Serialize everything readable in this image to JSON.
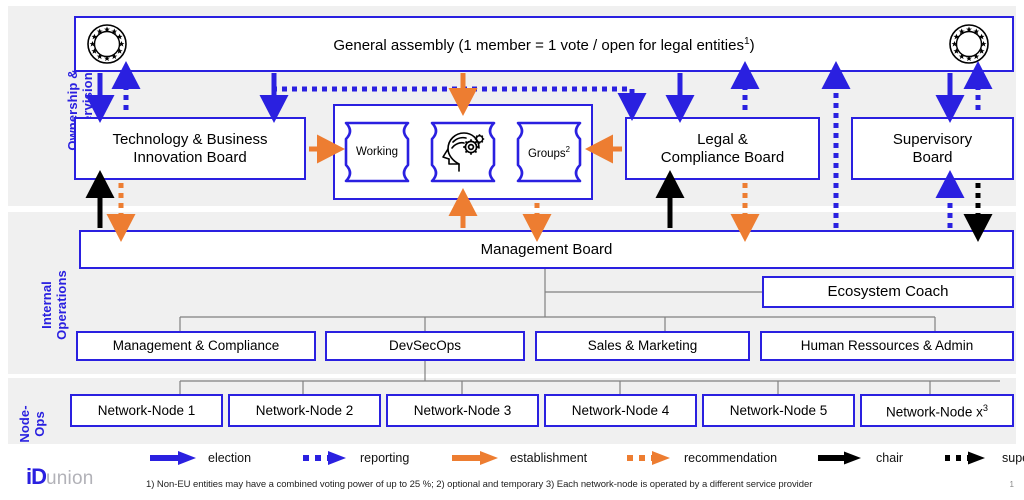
{
  "colors": {
    "blue": "#2a20e0",
    "orange": "#ed7d31",
    "black": "#000000",
    "band_bg": "#f0f0f0",
    "gray_connector": "#808080"
  },
  "bands": [
    {
      "id": "ownership",
      "label": "Ownership &\nSupervision"
    },
    {
      "id": "internal",
      "label": "Internal\nOperations"
    },
    {
      "id": "nodeops",
      "label": "Node-\nOps"
    }
  ],
  "ownership": {
    "general_assembly": {
      "label": "General assembly (1 member = 1 vote / open for legal entities",
      "footnote_marker": "1",
      "label_tail": ")",
      "icon_left": "eu-stars-icon",
      "icon_right": "eu-stars-icon"
    },
    "boards": [
      {
        "id": "tbib",
        "label": "Technology & Business\nInnovation Board"
      },
      {
        "id": "lcb",
        "label": "Legal &\nCompliance Board"
      },
      {
        "id": "supervisory",
        "label": "Supervisory\nBoard"
      }
    ],
    "working_groups": {
      "cells": [
        {
          "id": "wg-working",
          "label": "Working",
          "marker": ""
        },
        {
          "id": "wg-icon",
          "label": "",
          "marker": "",
          "icon": "head-gears-icon"
        },
        {
          "id": "wg-groups",
          "label": "Groups",
          "marker": "2"
        }
      ]
    }
  },
  "internal": {
    "management_board": {
      "label": "Management Board"
    },
    "ecosystem_coach": {
      "label": "Ecosystem Coach"
    },
    "departments": [
      {
        "id": "dept-mgmt-compliance",
        "label": "Management & Compliance"
      },
      {
        "id": "dept-devsecops",
        "label": "DevSecOps"
      },
      {
        "id": "dept-sales-marketing",
        "label": "Sales & Marketing"
      },
      {
        "id": "dept-hr-admin",
        "label": "Human Ressources & Admin"
      }
    ]
  },
  "nodeops": {
    "nodes": [
      {
        "id": "network-node-1",
        "label": "Network-Node 1",
        "marker": ""
      },
      {
        "id": "network-node-2",
        "label": "Network-Node 2",
        "marker": ""
      },
      {
        "id": "network-node-3",
        "label": "Network-Node 3",
        "marker": ""
      },
      {
        "id": "network-node-4",
        "label": "Network-Node 4",
        "marker": ""
      },
      {
        "id": "network-node-5",
        "label": "Network-Node 5",
        "marker": ""
      },
      {
        "id": "network-node-x",
        "label": "Network-Node x",
        "marker": "3"
      }
    ]
  },
  "legend": {
    "items": [
      {
        "id": "election",
        "label": "election",
        "style": "solid",
        "color": "#2a20e0"
      },
      {
        "id": "reporting",
        "label": "reporting",
        "style": "dotted",
        "color": "#2a20e0"
      },
      {
        "id": "establishment",
        "label": "establishment",
        "style": "solid",
        "color": "#ed7d31"
      },
      {
        "id": "recommendation",
        "label": "recommendation",
        "style": "dotted",
        "color": "#ed7d31"
      },
      {
        "id": "chair",
        "label": "chair",
        "style": "solid",
        "color": "#000000"
      },
      {
        "id": "supervision",
        "label": "supervision",
        "style": "dotted",
        "color": "#000000"
      }
    ]
  },
  "footnote": {
    "text": "1) Non-EU entities may have a combined voting power of up to 25 %; 2) optional and temporary 3) Each network-node is operated by a different service provider"
  },
  "page_number": "1",
  "logo": {
    "id_part": "iD",
    "union_part": "union"
  }
}
